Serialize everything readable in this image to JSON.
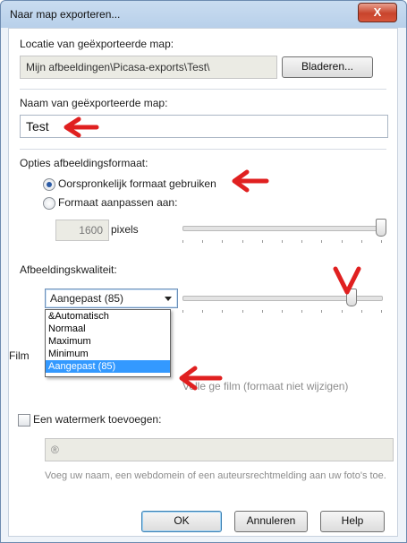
{
  "window": {
    "title": "Naar map exporteren...",
    "close_label": "X"
  },
  "location": {
    "label": "Locatie van geëxporteerde map:",
    "path": "Mijn afbeeldingen\\Picasa-exports\\Test\\",
    "browse_label": "Bladeren..."
  },
  "folder_name": {
    "label": "Naam van geëxporteerde map:",
    "value": "Test"
  },
  "image_size": {
    "label": "Opties afbeeldingsformaat:",
    "option_original": "Oorspronkelijk formaat gebruiken",
    "option_resize": "Formaat aanpassen aan:",
    "selected": "original",
    "pixels_value": "1600",
    "pixels_unit": "pixels",
    "slider_level": 1.0
  },
  "quality": {
    "label": "Afbeeldingskwaliteit:",
    "selected": "Aangepast (85)",
    "slider_level": 0.85,
    "options": [
      "&Automatisch",
      "Normaal",
      "Maximum",
      "Minimum",
      "Aangepast (85)"
    ]
  },
  "film": {
    "label_partial": "Film",
    "option_full": "Volledige film (formaat niet wijzigen)",
    "option_full_visible": "Volle  ge film (formaat niet wijzigen)"
  },
  "watermark": {
    "label": "Een watermerk toevoegen:",
    "checked": false,
    "value": "®",
    "hint": "Voeg uw naam, een webdomein of een auteursrechtmelding aan uw foto's toe."
  },
  "buttons": {
    "ok": "OK",
    "cancel": "Annuleren",
    "help": "Help"
  },
  "colors": {
    "annotation_arrow": "#e02020",
    "selection": "#3399ff"
  }
}
